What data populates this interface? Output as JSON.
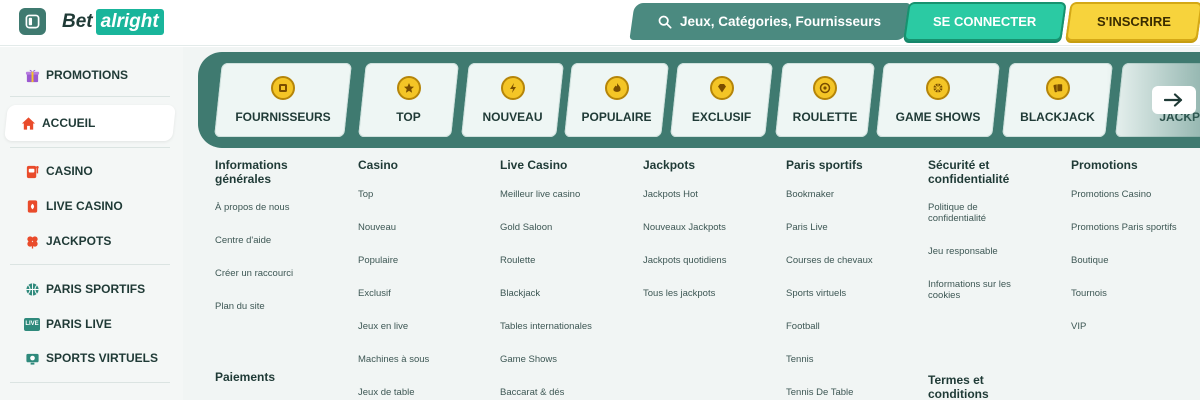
{
  "header": {
    "logo_part1": "Bet",
    "logo_part2": "alright",
    "search_placeholder": "Jeux, Catégories, Fournisseurs",
    "login_label": "SE CONNECTER",
    "signup_label": "S'INSCRIRE"
  },
  "sidebar": {
    "items": [
      {
        "label": "PROMOTIONS",
        "icon": "gift-icon"
      },
      {
        "label": "ACCUEIL",
        "icon": "home-icon"
      },
      {
        "label": "CASINO",
        "icon": "slot-machine-icon"
      },
      {
        "label": "LIVE CASINO",
        "icon": "playing-card-icon"
      },
      {
        "label": "JACKPOTS",
        "icon": "clover-icon"
      },
      {
        "label": "PARIS SPORTIFS",
        "icon": "basketball-icon"
      },
      {
        "label": "PARIS LIVE",
        "icon": "live-badge-icon",
        "badge_text": "LIVE"
      },
      {
        "label": "SPORTS VIRTUELS",
        "icon": "virtual-sports-icon"
      }
    ]
  },
  "categories": [
    {
      "label": "FOURNISSEURS",
      "icon": "providers-icon"
    },
    {
      "label": "TOP",
      "icon": "star-icon"
    },
    {
      "label": "NOUVEAU",
      "icon": "bolt-icon"
    },
    {
      "label": "POPULAIRE",
      "icon": "flame-icon"
    },
    {
      "label": "EXCLUSIF",
      "icon": "diamond-icon"
    },
    {
      "label": "ROULETTE",
      "icon": "roulette-icon"
    },
    {
      "label": "GAME SHOWS",
      "icon": "game-show-icon"
    },
    {
      "label": "BLACKJACK",
      "icon": "cards-icon"
    },
    {
      "label": "JACKPOTS",
      "icon": "jackpot-icon"
    }
  ],
  "footer": {
    "columns": [
      {
        "title": "Informations générales",
        "links": [
          "À propos de nous",
          "Centre d'aide",
          "Créer un raccourci",
          "Plan du site"
        ],
        "sub_title": "Paiements"
      },
      {
        "title": "Casino",
        "links": [
          "Top",
          "Nouveau",
          "Populaire",
          "Exclusif",
          "Jeux en live",
          "Machines à sous",
          "Jeux de table"
        ]
      },
      {
        "title": "Live Casino",
        "links": [
          "Meilleur live casino",
          "Gold Saloon",
          "Roulette",
          "Blackjack",
          "Tables internationales",
          "Game Shows",
          "Baccarat & dés"
        ]
      },
      {
        "title": "Jackpots",
        "links": [
          "Jackpots Hot",
          "Nouveaux Jackpots",
          "Jackpots quotidiens",
          "Tous les jackpots"
        ]
      },
      {
        "title": "Paris sportifs",
        "links": [
          "Bookmaker",
          "Paris Live",
          "Courses de chevaux",
          "Sports virtuels",
          "Football",
          "Tennis",
          "Tennis De Table"
        ]
      },
      {
        "title": "Sécurité et confidentialité",
        "links": [
          "Politique de confidentialité",
          "Jeu responsable",
          "Informations sur les cookies"
        ],
        "sub_title": "Termes et conditions"
      },
      {
        "title": "Promotions",
        "links": [
          "Promotions Casino",
          "Promotions Paris sportifs",
          "Boutique",
          "Tournois",
          "VIP"
        ]
      }
    ]
  },
  "colors": {
    "brand_teal": "#3f7a70",
    "login_green": "#2bcaa3",
    "signup_yellow": "#f7d33c",
    "accent_red": "#e94b2b",
    "badge_gold": "#f4c526"
  }
}
